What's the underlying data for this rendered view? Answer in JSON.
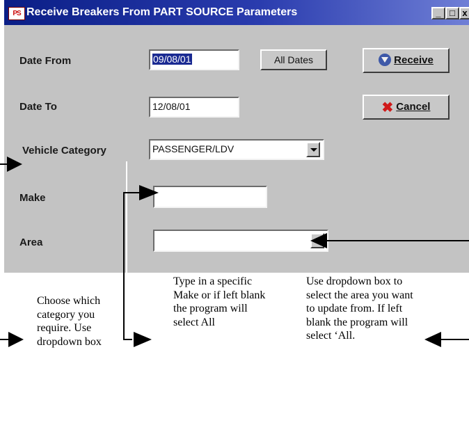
{
  "window": {
    "title": "Receive Breakers From PART SOURCE Parameters",
    "app_icon_text": "PS",
    "controls": {
      "minimize": "_",
      "maximize": "□",
      "close": "x"
    }
  },
  "fields": {
    "date_from": {
      "label": "Date From",
      "value": "09/08/01"
    },
    "date_to": {
      "label": "Date To",
      "value": "12/08/01"
    },
    "vehicle_category": {
      "label": "Vehicle Category",
      "value": "PASSENGER/LDV"
    },
    "make": {
      "label": "Make",
      "value": ""
    },
    "area": {
      "label": "Area",
      "value": ""
    }
  },
  "buttons": {
    "all_dates": "All Dates",
    "receive": "Receive",
    "cancel": "Cancel"
  },
  "annotations": {
    "category_note": "Choose which category you require. Use dropdown box",
    "make_note": "Type in a specific Make or if left blank the program will select All",
    "area_note": "Use dropdown box to select the area you want to update from. If left blank the program will select ‘All."
  },
  "icons": [
    "receive-icon",
    "cancel-icon",
    "dropdown-arrow-icon",
    "annotation-arrow-icon"
  ]
}
